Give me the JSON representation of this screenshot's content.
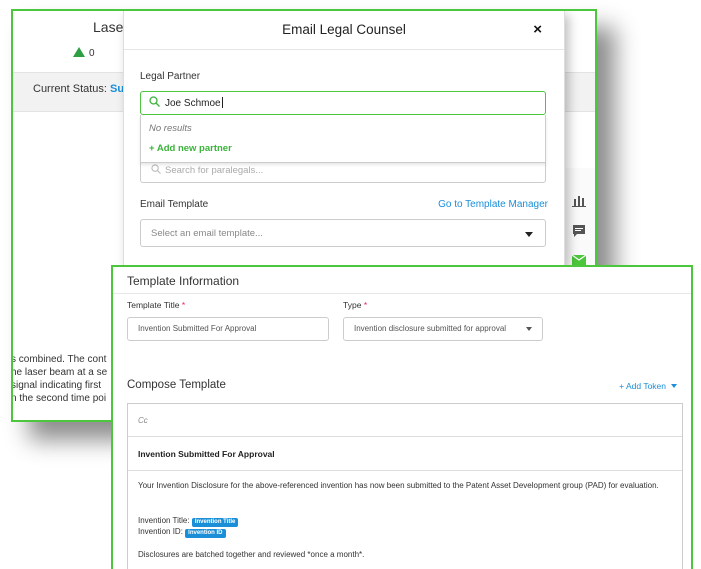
{
  "background": {
    "title": "Laser",
    "vote_count": "0",
    "status_label": "Current Status:",
    "status_value": "Sub",
    "body_lines": [
      "s combined. The cont",
      "he laser beam at a se",
      "signal indicating first",
      "n the second time poi"
    ]
  },
  "modal": {
    "title": "Email Legal Counsel",
    "close_glyph": "×",
    "legal_partner_label": "Legal Partner",
    "search_value": "Joe Schmoe",
    "no_results": "No results",
    "add_partner": "+ Add new partner",
    "paralegal_placeholder": "Search for paralegals...",
    "email_template_label": "Email Template",
    "template_manager_link": "Go to Template Manager",
    "template_placeholder": "Select an email template..."
  },
  "template": {
    "section_title": "Template Information",
    "title_label": "Template Title",
    "type_label": "Type",
    "required_mark": "*",
    "title_value": "Invention Submitted For Approval",
    "type_value": "Invention disclosure submitted for approval",
    "compose_title": "Compose Template",
    "add_token": "+ Add Token",
    "cc_placeholder": "Cc",
    "subject": "Invention Submitted For Approval",
    "body_paragraph": "Your Invention Disclosure for the above-referenced invention has now been submitted to the Patent Asset Development group (PAD) for evaluation.",
    "invention_title_label": "Invention Title:",
    "invention_title_token": "Invention Title",
    "invention_id_label": "Invention ID:",
    "invention_id_token": "Invention ID",
    "batch_note": "Disclosures are batched together and reviewed *once a month*."
  },
  "colors": {
    "accent_green": "#4cc63d",
    "link_blue": "#1a8fd8"
  },
  "icons": [
    "search-icon",
    "close-icon",
    "chevron-down-icon",
    "vote-up-icon",
    "bar-chart-icon",
    "comment-icon",
    "mail-icon"
  ]
}
